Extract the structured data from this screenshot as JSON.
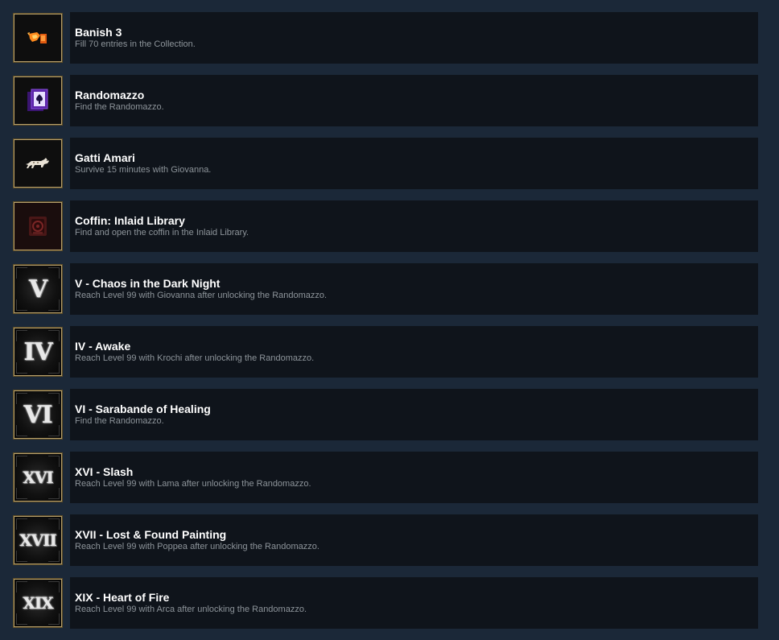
{
  "achievements": [
    {
      "title": "Banish 3",
      "description": "Fill 70 entries in the Collection.",
      "icon": "banish-icon"
    },
    {
      "title": "Randomazzo",
      "description": "Find the Randomazzo.",
      "icon": "randomazzo-card-icon"
    },
    {
      "title": "Gatti Amari",
      "description": "Survive 15 minutes with Giovanna.",
      "icon": "cat-icon"
    },
    {
      "title": "Coffin: Inlaid Library",
      "description": "Find and open the coffin in the Inlaid Library.",
      "icon": "coffin-icon"
    },
    {
      "title": "V - Chaos in the Dark Night",
      "description": "Reach Level 99 with Giovanna after unlocking the Randomazzo.",
      "icon": "roman-v-icon",
      "numeral": "V"
    },
    {
      "title": "IV - Awake",
      "description": "Reach Level 99 with Krochi after unlocking the Randomazzo.",
      "icon": "roman-iv-icon",
      "numeral": "IV"
    },
    {
      "title": "VI - Sarabande of Healing",
      "description": "Find the Randomazzo.",
      "icon": "roman-vi-icon",
      "numeral": "VI"
    },
    {
      "title": "XVI - Slash",
      "description": "Reach Level 99 with Lama after unlocking the Randomazzo.",
      "icon": "roman-xvi-icon",
      "numeral": "XVI"
    },
    {
      "title": "XVII - Lost & Found Painting",
      "description": "Reach Level 99 with Poppea after unlocking the Randomazzo.",
      "icon": "roman-xvii-icon",
      "numeral": "XVII"
    },
    {
      "title": "XIX - Heart of Fire",
      "description": "Reach Level 99 with Arca after unlocking the Randomazzo.",
      "icon": "roman-xix-icon",
      "numeral": "XIX"
    }
  ],
  "colors": {
    "page_background": "#1b2838",
    "row_background": "#0f141b",
    "icon_border": "#b7a06c",
    "title_text": "#ffffff",
    "description_text": "#8d949a"
  }
}
